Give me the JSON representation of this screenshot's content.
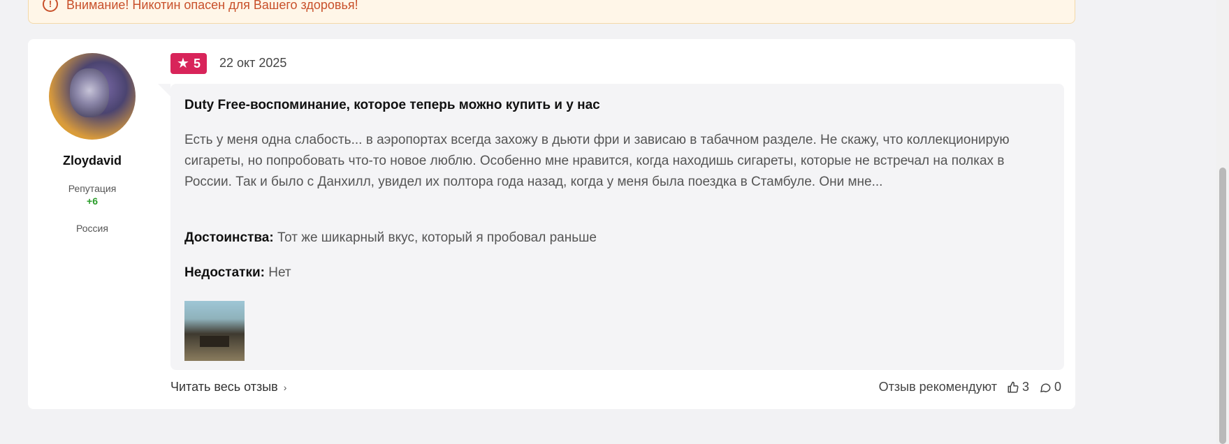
{
  "warning": {
    "text": "Внимание! Никотин опасен для Вашего здоровья!"
  },
  "review": {
    "author": {
      "name": "Zloydavid",
      "reputation_label": "Репутация",
      "reputation_value": "+6",
      "country": "Россия"
    },
    "rating": "5",
    "date": "22 окт 2025",
    "title": "Duty Free-воспоминание, которое теперь можно купить и у нас",
    "text": "Есть у меня одна слабость... в аэропортах всегда захожу в дьюти фри и зависаю в табачном разделе. Не скажу, что коллекционирую сигареты, но попробовать что-то новое люблю. Особенно мне нравится, когда находишь сигареты, которые не встречал на полках в России. Так и было с Данхилл, увидел их полтора года назад, когда у меня была поездка в Стамбуле. Они мне...",
    "pros_label": "Достоинства:",
    "pros": "Тот же шикарный вкус, который я пробовал раньше",
    "cons_label": "Недостатки:",
    "cons": "Нет",
    "read_more": "Читать весь отзыв",
    "recommend_label": "Отзыв рекомендуют",
    "likes": "3",
    "comments": "0"
  },
  "colors": {
    "badge": "#d8245a",
    "reputation": "#2a9d2a",
    "warning_text": "#c8502a"
  }
}
